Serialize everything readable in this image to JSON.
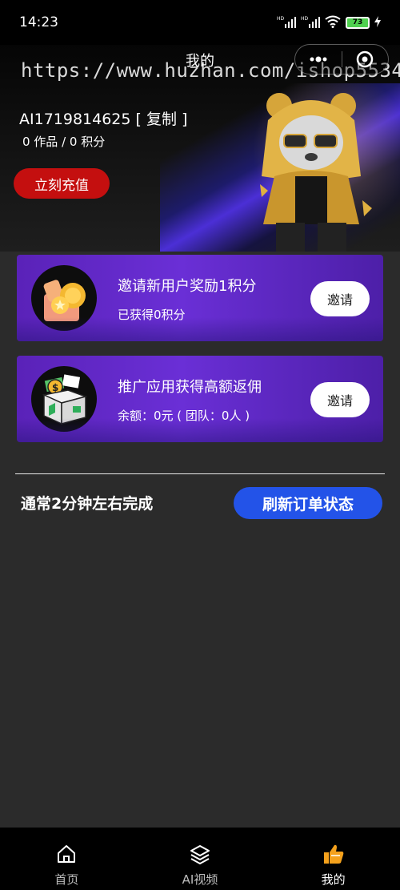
{
  "status_bar": {
    "time": "14:23",
    "battery": "73"
  },
  "header": {
    "title": "我的",
    "watermark": "https://www.huzhan.com/ishop5534",
    "user_id": "AI1719814625 [ 复制 ]",
    "stats": "0 作品 / 0 积分",
    "recharge_label": "立刻充值"
  },
  "cards": [
    {
      "title": "邀请新用户奖励1积分",
      "subtitle": "已获得0积分",
      "button": "邀请",
      "icon": "gift-coin-icon"
    },
    {
      "title": "推广应用获得高额返佣",
      "subtitle": "余额：0元 ( 团队：0人 )",
      "button": "邀请",
      "icon": "money-box-icon"
    }
  ],
  "order": {
    "hint": "通常2分钟左右完成",
    "refresh_label": "刷新订单状态"
  },
  "tabbar": {
    "items": [
      {
        "label": "首页",
        "icon": "home-icon"
      },
      {
        "label": "AI视频",
        "icon": "layers-icon"
      },
      {
        "label": "我的",
        "icon": "thumbs-up-icon"
      }
    ],
    "active": "我的"
  },
  "colors": {
    "accent_blue": "#2353e8",
    "recharge_red": "#c40f0f",
    "card_purple": "#6a2fd6",
    "battery_green": "#4fd14f"
  }
}
